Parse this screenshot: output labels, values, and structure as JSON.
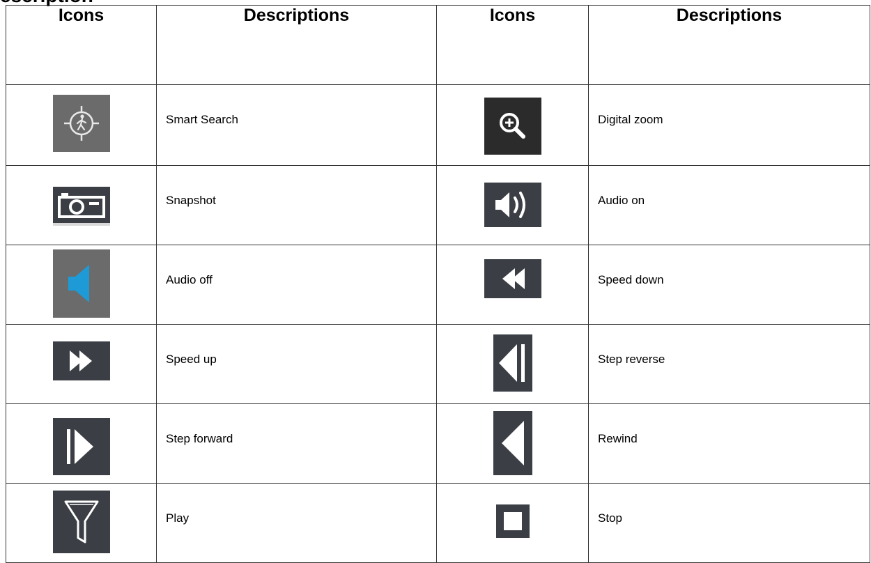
{
  "heading_fragment": "escription",
  "headers": {
    "icons_1": "Icons",
    "descriptions_1": "Descriptions",
    "icons_2": "Icons",
    "descriptions_2": "Descriptions"
  },
  "rows": [
    {
      "left": {
        "icon": "smart-search-icon",
        "desc": "Smart Search"
      },
      "right": {
        "icon": "digital-zoom-icon",
        "desc": "Digital zoom"
      }
    },
    {
      "left": {
        "icon": "snapshot-camera-icon",
        "desc": "Snapshot"
      },
      "right": {
        "icon": "audio-on-icon",
        "desc": "Audio on"
      }
    },
    {
      "left": {
        "icon": "audio-off-icon",
        "desc": "Audio off"
      },
      "right": {
        "icon": "speed-down-icon",
        "desc": "Speed down"
      }
    },
    {
      "left": {
        "icon": "speed-up-icon",
        "desc": "Speed up"
      },
      "right": {
        "icon": "step-reverse-icon",
        "desc": "Step reverse"
      }
    },
    {
      "left": {
        "icon": "step-forward-icon",
        "desc": "Step forward"
      },
      "right": {
        "icon": "rewind-icon",
        "desc": "Rewind"
      }
    },
    {
      "left": {
        "icon": "filter-funnel-icon",
        "desc": "Play"
      },
      "right": {
        "icon": "stop-icon",
        "desc": "Stop"
      }
    }
  ],
  "colors": {
    "icon_bg_dark": "#3b3f45",
    "icon_bg_gray": "#6b6b6b",
    "zoom_bg": "#2b2b2b",
    "audio_off_accent": "#1e9ad6",
    "icon_fg": "#ffffff"
  }
}
